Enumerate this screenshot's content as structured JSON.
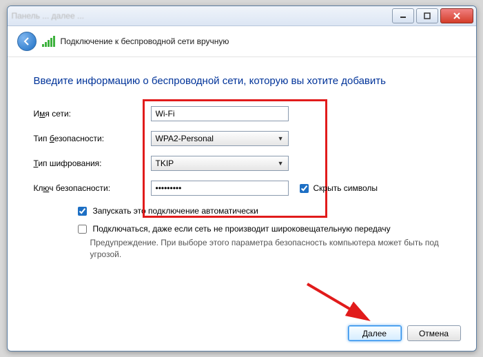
{
  "titlebar": {
    "blurred": "Панель ... далее ..."
  },
  "header": {
    "title": "Подключение к беспроводной сети вручную"
  },
  "page_title": "Введите информацию о беспроводной сети, которую вы хотите добавить",
  "labels": {
    "ssid_pre": "И",
    "ssid_u": "м",
    "ssid_post": "я сети:",
    "sec_pre": "Тип ",
    "sec_u": "б",
    "sec_post": "езопасности:",
    "enc_u": "Т",
    "enc_post": "ип шифрования:",
    "key_pre": "Кл",
    "key_u": "ю",
    "key_post": "ч безопасности:"
  },
  "fields": {
    "ssid": "Wi-Fi",
    "security_type": "WPA2-Personal",
    "encryption_type": "TKIP",
    "key": "•••••••••"
  },
  "hide_chars": {
    "checked": true,
    "u": "С",
    "post": "крыть символы"
  },
  "auto_start": {
    "checked": true,
    "u": "З",
    "post": "апускать это подключение автоматически"
  },
  "connect_hidden": {
    "checked": false,
    "u": "П",
    "post": "одключаться, даже если сеть не производит широковещательную передачу"
  },
  "warning": "Предупреждение. При выборе этого параметра безопасность компьютера может быть под угрозой.",
  "buttons": {
    "next": "Далее",
    "cancel": "Отмена"
  }
}
